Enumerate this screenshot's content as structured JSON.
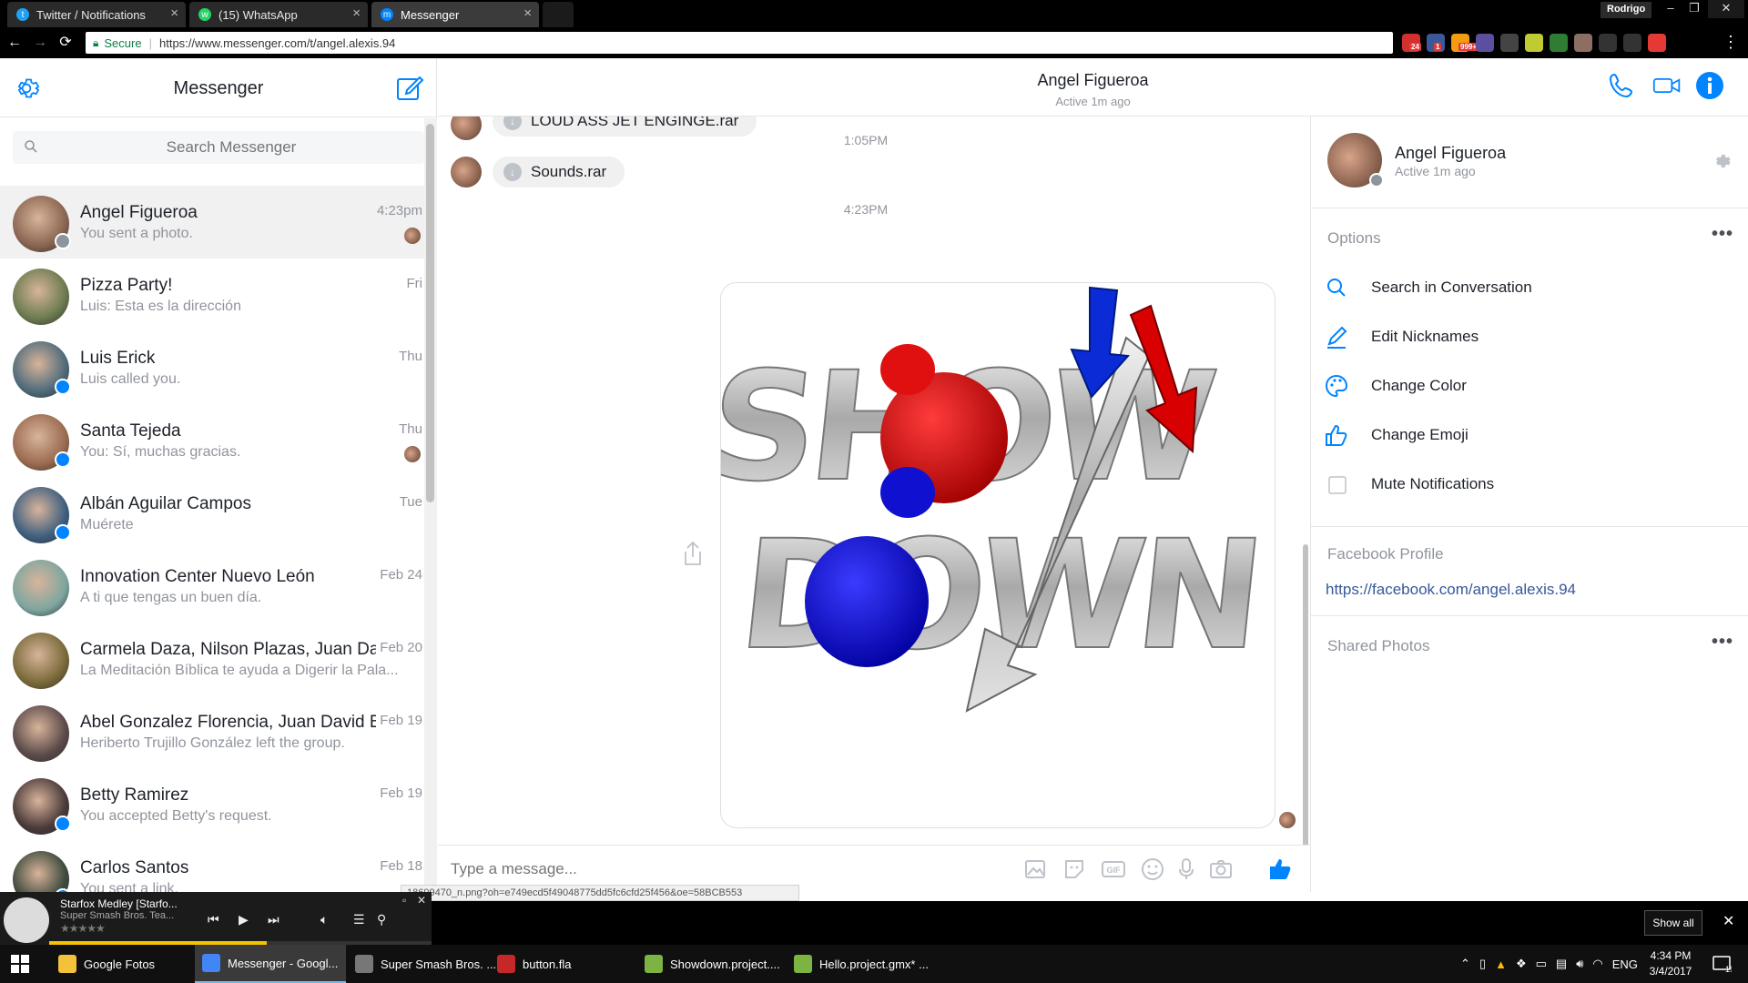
{
  "browser": {
    "tabs": [
      {
        "label": "Twitter / Notifications",
        "icon": "twitter-icon"
      },
      {
        "label": "(15) WhatsApp",
        "icon": "whatsapp-icon"
      },
      {
        "label": "Messenger",
        "icon": "messenger-icon"
      }
    ],
    "profile": "Rodrigo",
    "secure_label": "Secure",
    "url": "https://www.messenger.com/t/angel.alexis.94",
    "extensions": [
      {
        "icon": "gmail-icon",
        "badge": "24",
        "color": "#d32f2f"
      },
      {
        "icon": "facebook-icon",
        "badge": "1",
        "color": "#3b5998"
      },
      {
        "icon": "rss-icon",
        "badge": "999+",
        "color": "#f39c12"
      },
      {
        "icon": "extension-icon",
        "badge": "",
        "color": "#5d4fa0"
      },
      {
        "icon": "extension-icon",
        "badge": "",
        "color": "#444444"
      },
      {
        "icon": "extension-icon",
        "badge": "",
        "color": "#c0ca33"
      },
      {
        "icon": "extension-icon",
        "badge": "",
        "color": "#2e7d32"
      },
      {
        "icon": "extension-icon",
        "badge": "",
        "color": "#8d6e63"
      },
      {
        "icon": "twitter-icon",
        "badge": "",
        "color": "#333333"
      },
      {
        "icon": "extension-icon",
        "badge": "",
        "color": "#333333"
      },
      {
        "icon": "extension-icon",
        "badge": "",
        "color": "#e53935"
      }
    ]
  },
  "messenger": {
    "title": "Messenger",
    "search_placeholder": "Search Messenger",
    "conversations": [
      {
        "name": "Angel Figueroa",
        "snippet": "You sent a photo.",
        "time": "4:23pm",
        "active": true
      },
      {
        "name": "Pizza Party!",
        "snippet": "Luis: Esta es la dirección",
        "time": "Fri"
      },
      {
        "name": "Luis Erick",
        "snippet": "Luis called you.",
        "time": "Thu"
      },
      {
        "name": "Santa Tejeda",
        "snippet": "You: Sí, muchas gracias.",
        "time": "Thu"
      },
      {
        "name": "Albán Aguilar Campos",
        "snippet": "Muérete",
        "time": "Tue"
      },
      {
        "name": "Innovation Center Nuevo León",
        "snippet": "A ti que tengas un buen día.",
        "time": "Feb 24"
      },
      {
        "name": "Carmela Daza, Nilson Plazas, Juan Dav...",
        "snippet": "La Meditación Bíblica te ayuda a Digerir la Pala...",
        "time": "Feb 20"
      },
      {
        "name": "Abel Gonzalez Florencia, Juan David B...",
        "snippet": "Heriberto Trujillo González left the group.",
        "time": "Feb 19"
      },
      {
        "name": "Betty Ramirez",
        "snippet": "You accepted Betty's request.",
        "time": "Feb 19"
      },
      {
        "name": "Carlos Santos",
        "snippet": "You sent a link.",
        "time": "Feb 18"
      }
    ]
  },
  "chat": {
    "name": "Angel Figueroa",
    "active": "Active 1m ago",
    "messages": [
      {
        "file": "LOUD ASS JET ENGINGE.rar"
      },
      {
        "timestamp": "1:05PM"
      },
      {
        "file": "Sounds.rar"
      },
      {
        "timestamp": "4:23PM"
      }
    ],
    "image_text": [
      "SHOW",
      "DOWN"
    ],
    "composer_placeholder": "Type a message..."
  },
  "info_panel": {
    "name": "Angel Figueroa",
    "active": "Active 1m ago",
    "options_header": "Options",
    "options": [
      {
        "label": "Search in Conversation",
        "icon": "search-icon"
      },
      {
        "label": "Edit Nicknames",
        "icon": "pencil-icon"
      },
      {
        "label": "Change Color",
        "icon": "palette-icon"
      },
      {
        "label": "Change Emoji",
        "icon": "thumbs-up-icon"
      },
      {
        "label": "Mute Notifications",
        "icon": "checkbox-icon"
      }
    ],
    "profile_header": "Facebook Profile",
    "profile_url": "https://facebook.com/angel.alexis.94",
    "shared_header": "Shared Photos"
  },
  "status_url": "18699470_n.png?oh=e749ecd5f49048775dd5fc6cfd25f456&oe=58BCB553",
  "player": {
    "title": "Starfox Medley [Starfo...",
    "artist": "Super Smash Bros. Tea...",
    "stars": "★★★★★",
    "progress": 0.57
  },
  "download_bar": {
    "show_all": "Show all"
  },
  "taskbar": {
    "items": [
      {
        "label": "Google Fotos",
        "icon": "folder-icon",
        "color": "#f3c13a"
      },
      {
        "label": "Messenger - Googl...",
        "icon": "chrome-icon",
        "color": "#4285f4",
        "active": true
      },
      {
        "label": "Super Smash Bros. ...",
        "icon": "media-player-icon",
        "color": "#777777"
      },
      {
        "label": "button.fla",
        "icon": "flash-icon",
        "color": "#c62828"
      },
      {
        "label": "Showdown.project....",
        "icon": "gamemaker-icon",
        "color": "#7cb342"
      },
      {
        "label": "Hello.project.gmx* ...",
        "icon": "gamemaker-icon",
        "color": "#7cb342"
      }
    ],
    "language": "ENG",
    "time": "4:34 PM",
    "date": "3/4/2017",
    "notifications": "19"
  },
  "colors": {
    "accent": "#0084ff",
    "link": "#365899",
    "muted": "#90949c"
  }
}
